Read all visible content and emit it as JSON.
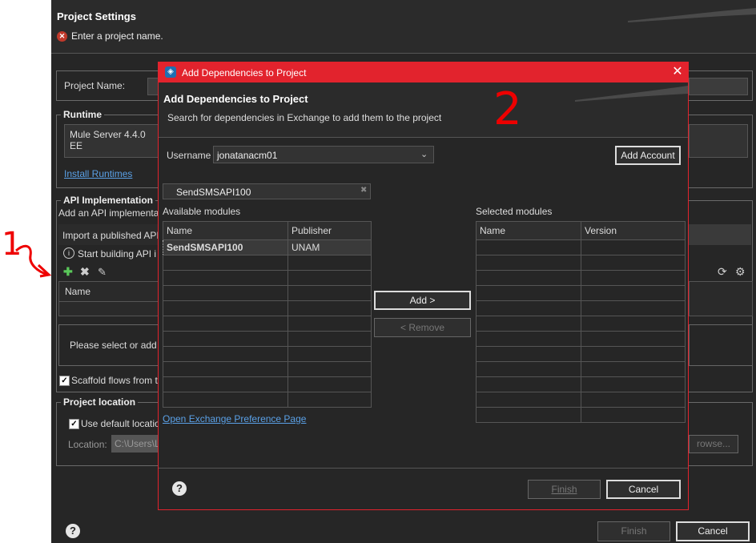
{
  "project_settings": {
    "title": "Project Settings",
    "error_message": "Enter a project name.",
    "project_name_label": "Project Name:",
    "runtime_group": "Runtime",
    "runtime_value": "Mule Server 4.4.0 EE",
    "install_runtimes_link": "Install Runtimes",
    "api_group": "API Implementation",
    "api_desc": "Add an API implementati",
    "import_label": "Import a published API",
    "start_building": "Start building API i",
    "table_name_header": "Name",
    "please_select": "Please select or add a",
    "scaffold_label": "Scaffold flows from t",
    "location_group": "Project location",
    "use_default_label": "Use default locatio",
    "location_label": "Location:",
    "location_value": "C:\\Users\\L",
    "browse_label": "rowse...",
    "finish_label": "Finish",
    "cancel_label": "Cancel",
    "help_glyph": "?"
  },
  "dialog": {
    "window_title": "Add Dependencies to Project",
    "header_title": "Add Dependencies to Project",
    "header_subtitle": "Search for dependencies in Exchange to add them to the project",
    "username_label": "Username",
    "username_value": "jonatanacm01",
    "add_account_label": "Add Account",
    "search_value": "SendSMSAPI100",
    "available_label": "Available modules",
    "selected_label": "Selected modules",
    "available_columns": [
      "Name",
      "Publisher"
    ],
    "available_rows": [
      {
        "name": "SendSMSAPI100",
        "publisher": "UNAM"
      }
    ],
    "selected_columns": [
      "Name",
      "Version"
    ],
    "add_label": "Add >",
    "remove_label": "< Remove",
    "exchange_link": "Open Exchange Preference Page",
    "finish_label": "Finish",
    "cancel_label": "Cancel",
    "help_glyph": "?"
  },
  "annotations": {
    "step1": "1",
    "step2": "2"
  },
  "colors": {
    "accent_red": "#e2232d",
    "background": "#262626",
    "link": "#5aa0e6",
    "annotation": "#e00000"
  }
}
